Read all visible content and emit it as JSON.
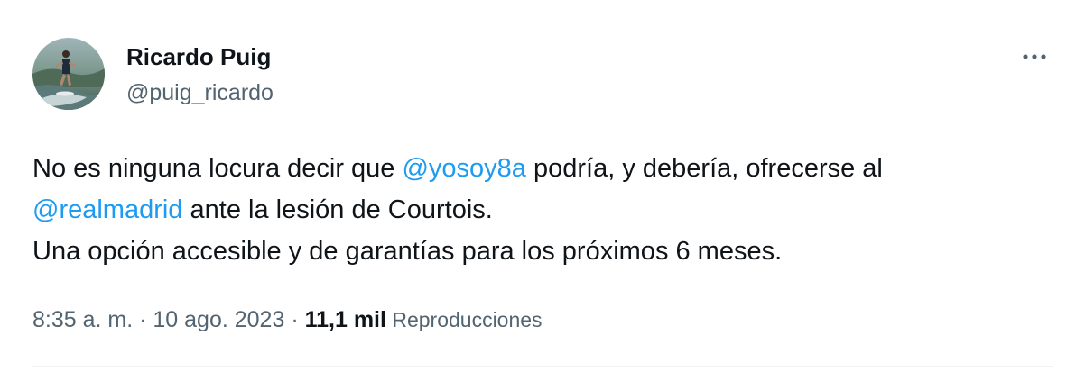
{
  "author": {
    "name": "Ricardo Puig",
    "handle": "@puig_ricardo"
  },
  "tweet": {
    "line1_pre": "No es ninguna locura decir que ",
    "line1_mention": "@yosoy8a",
    "line1_post": " podría, y debería, ofrecerse al",
    "line2_mention": "@realmadrid",
    "line2_post": " ante la lesión de Courtois.",
    "line3": "Una opción accesible y de garantías para los próximos 6 meses."
  },
  "meta": {
    "time": "8:35 a. m.",
    "sep1": " · ",
    "date": "10 ago. 2023",
    "sep2": " · ",
    "views_count": "11,1 mil",
    "views_label": " Reproducciones"
  },
  "colors": {
    "text": "#0f1419",
    "secondary": "#536471",
    "link": "#1d9bf0",
    "divider": "#eff3f4"
  },
  "icons": {
    "more": "more-horizontal-icon",
    "avatar": "profile-photo-surfer"
  }
}
